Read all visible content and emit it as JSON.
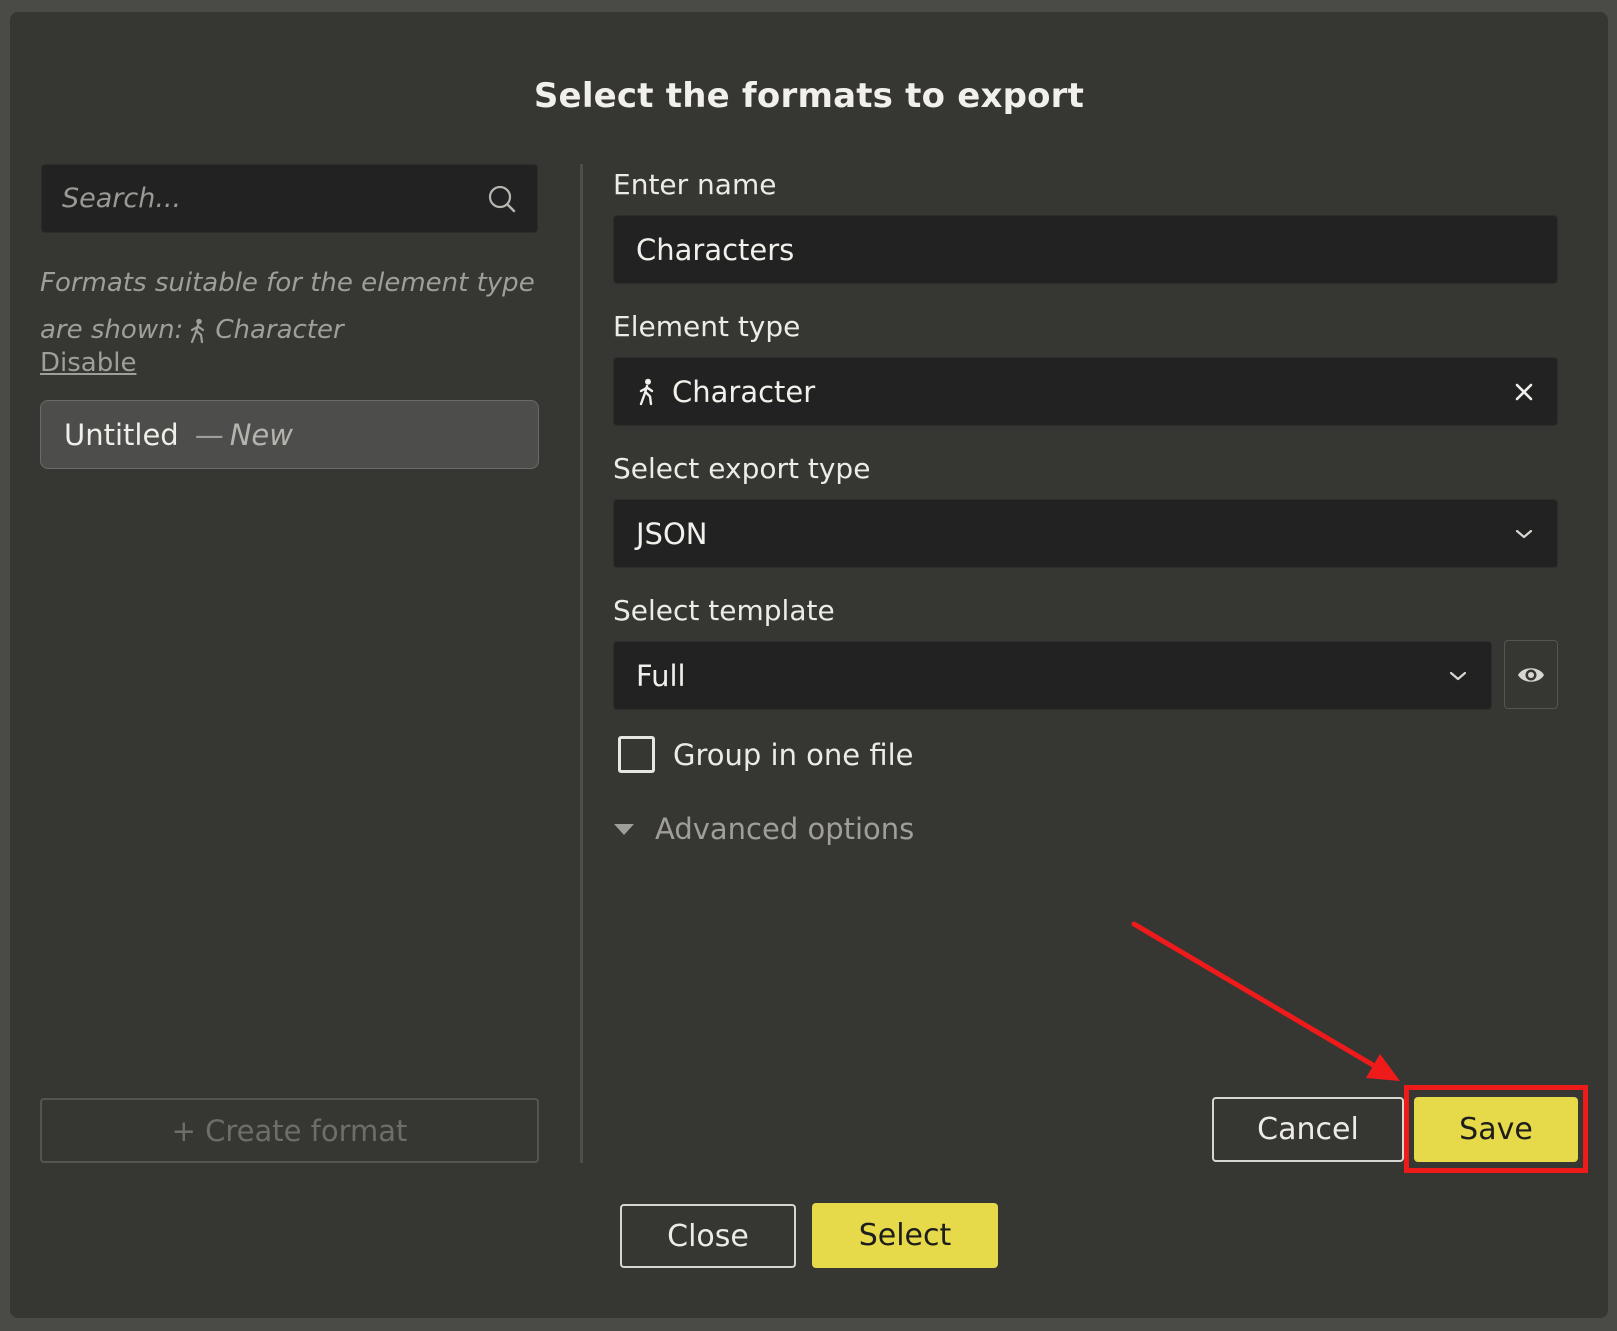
{
  "dialog": {
    "title": "Select the formats to export"
  },
  "left_panel": {
    "search_placeholder": "Search...",
    "hint_line1": "Formats suitable for the element type",
    "hint_line2_prefix": "are shown:",
    "hint_element_type": "Character",
    "disable_link": "Disable",
    "formats": [
      {
        "name": "Untitled",
        "dash": "—",
        "status": "New"
      }
    ],
    "create_format_label": "+ Create format"
  },
  "form": {
    "name_label": "Enter name",
    "name_value": "Characters",
    "element_type_label": "Element type",
    "element_type_value": "Character",
    "export_type_label": "Select export type",
    "export_type_value": "JSON",
    "template_label": "Select template",
    "template_value": "Full",
    "group_checkbox_label": "Group in one file",
    "group_checkbox_checked": false,
    "advanced_options_label": "Advanced options",
    "cancel_label": "Cancel",
    "save_label": "Save"
  },
  "footer": {
    "close_label": "Close",
    "select_label": "Select"
  },
  "colors": {
    "accent_yellow": "#e6d94a",
    "annotation_red": "#ef1b1b",
    "modal_bg": "#363633",
    "input_bg": "#222222"
  },
  "icons": {
    "search": "search-icon",
    "walking_person": "walking-person-icon",
    "clear": "close-icon",
    "dropdown": "chevron-down-icon",
    "preview": "eye-icon",
    "expand": "caret-down-icon"
  }
}
